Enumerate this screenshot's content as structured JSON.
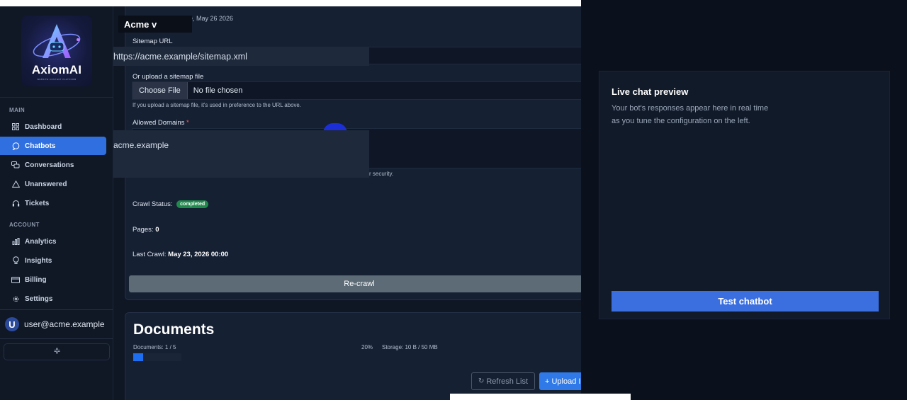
{
  "colors": {
    "accent": "#2f6fe0",
    "success": "#1f8a4c",
    "danger": "#ff5c5c",
    "recrawl": "#5d6b76"
  },
  "brand": {
    "name": "AxiomAI",
    "tagline": "WEBSITE CONTENT PLATFORM"
  },
  "sidebar": {
    "section_main": "MAIN",
    "section_account": "ACCOUNT",
    "items": [
      {
        "label": "Dashboard",
        "icon": "grid-icon"
      },
      {
        "label": "Chatbots",
        "icon": "chat-bubble-icon",
        "active": true
      },
      {
        "label": "Conversations",
        "icon": "conversations-icon"
      },
      {
        "label": "Unanswered",
        "icon": "warning-icon"
      },
      {
        "label": "Tickets",
        "icon": "headset-icon"
      },
      {
        "label": "Analytics",
        "icon": "bar-chart-icon"
      },
      {
        "label": "Insights",
        "icon": "lightbulb-icon"
      },
      {
        "label": "Billing",
        "icon": "credit-card-icon"
      },
      {
        "label": "Settings",
        "icon": "gear-icon"
      }
    ],
    "user": {
      "initial": "U",
      "email": "user@acme.example"
    }
  },
  "chatbot_form": {
    "bot_selector": "Acme   v",
    "date_text": "e, May 26 2026",
    "sitemap_label": "Sitemap URL",
    "sitemap_value": "https://acme.example/sitemap.xml",
    "upload_label": "Or upload a sitemap file",
    "choose_file": "Choose File",
    "no_file": "No file chosen",
    "upload_hint": "If you upload a sitemap file, it's used in preference to the URL above.",
    "domains_label": "Allowed Domains",
    "required_mark": "*",
    "domains_value": "acme.example",
    "security_hint": "r security.",
    "crawl_status_label": "Crawl Status:",
    "crawl_status": "completed",
    "pages_label": "Pages:",
    "pages_value": "0",
    "last_crawl_label": "Last Crawl:",
    "last_crawl_value": "May 23, 2026 00:00",
    "recrawl_button": "Re-crawl"
  },
  "documents": {
    "title": "Documents",
    "count": "Documents: 1 / 5",
    "percent": "20%",
    "storage": "Storage: 10 B / 50 MB",
    "progress": 0.2,
    "refresh_button": "Refresh List",
    "upload_button": "+ Upload I"
  },
  "preview": {
    "title": "Live chat preview",
    "line1": "Your bot's responses appear here in real time",
    "line2": "as you tune the configuration on the left.",
    "test_button": "Test chatbot"
  }
}
